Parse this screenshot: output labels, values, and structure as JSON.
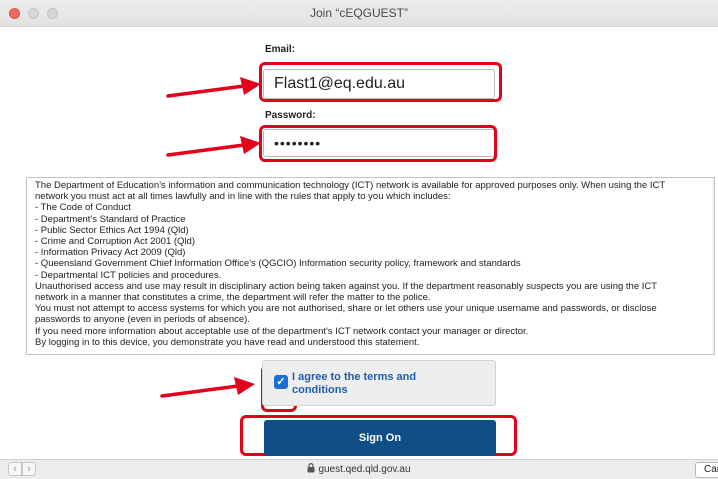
{
  "window": {
    "title": "Join “cEQGUEST”"
  },
  "form": {
    "email_label": "Email:",
    "email_value": "Flast1@eq.edu.au",
    "password_label": "Password:",
    "password_value": "••••••••"
  },
  "terms": {
    "lines": [
      "The Department of Education’s information and communication technology (ICT) network is available for approved purposes only. When using the ICT",
      "network you must act at all times lawfully and in line with the rules that apply to you which includes:",
      "- The Code of Conduct",
      "- Department's Standard of Practice",
      "- Public Sector Ethics Act 1994 (Qld)",
      "- Crime and Corruption Act 2001 (Qld)",
      "- Information Privacy Act 2009 (Qld)",
      "- Queensland Government Chief Information Office's (QGCIO) Information security policy, framework and standards",
      "- Departmental ICT policies and procedures.",
      "Unauthorised access and use may result in disciplinary action being taken against you. If the department reasonably suspects you are using the ICT",
      "network in a manner that constitutes a crime, the department will refer the matter to the police.",
      "You must not attempt to access systems for which you are not authorised, share or let others use your unique username and passwords, or disclose",
      "passwords to anyone (even in periods of absence).",
      "If you need more information about acceptable use of the department's ICT network contact your manager or director.",
      "By logging in to this device, you demonstrate you have read and understood this statement."
    ]
  },
  "agree": {
    "checked": true,
    "label": "I agree to the terms and conditions"
  },
  "sign_on_label": "Sign On",
  "bottom": {
    "url": "guest.qed.qld.gov.au",
    "cancel_label": "Cancel"
  },
  "colors": {
    "highlight": "#e3001b",
    "button": "#0f4f86",
    "link_text": "#1f5ea8",
    "checkbox": "#1d6fd6"
  },
  "icons": [
    "close-icon",
    "minimize-icon",
    "maximize-icon",
    "arrow-icon",
    "checkmark-icon",
    "chevron-left-icon",
    "chevron-right-icon",
    "lock-icon"
  ]
}
